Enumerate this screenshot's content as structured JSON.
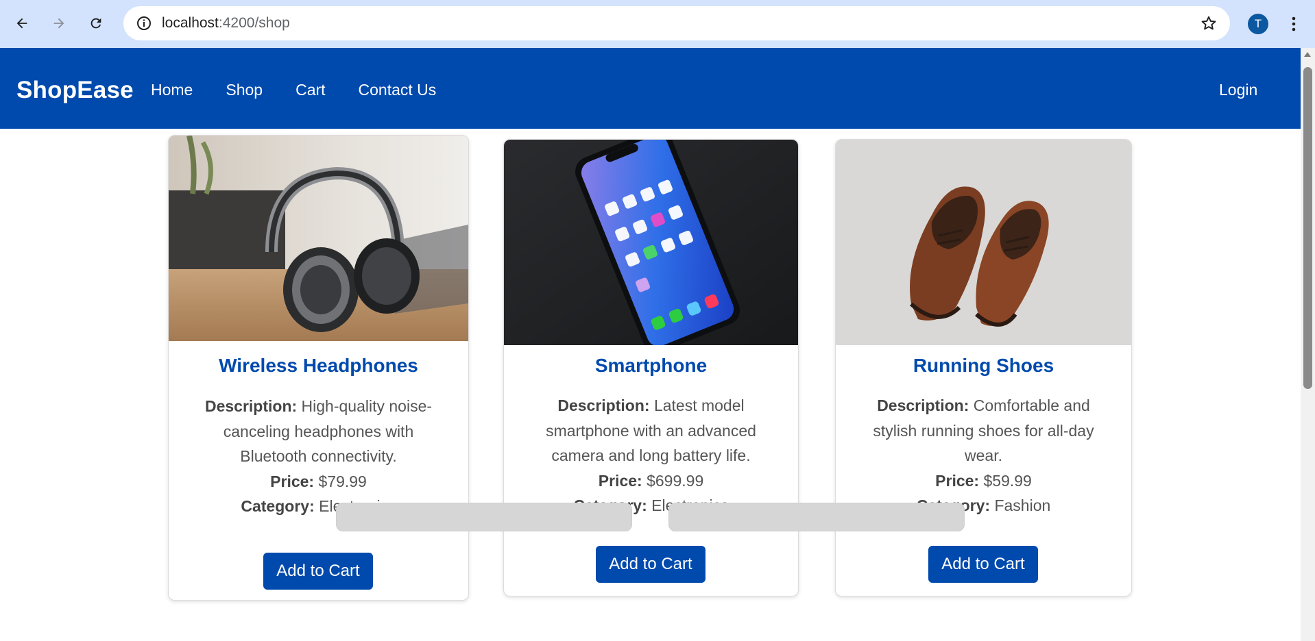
{
  "browser": {
    "url_host": "localhost",
    "url_path": ":4200/shop",
    "profile_initial": "T"
  },
  "navbar": {
    "brand": "ShopEase",
    "links": [
      "Home",
      "Shop",
      "Cart",
      "Contact Us"
    ],
    "login": "Login",
    "bg_color": "#004aad"
  },
  "products": [
    {
      "title": "Wireless Headphones",
      "description_label": "Description:",
      "description": "High-quality noise-canceling headphones with Bluetooth connectivity.",
      "price_label": "Price:",
      "price": "$79.99",
      "category_label": "Category:",
      "category": "Electronics",
      "button": "Add to Cart",
      "image": "headphones-photo"
    },
    {
      "title": "Smartphone",
      "description_label": "Description:",
      "description": "Latest model smartphone with an advanced camera and long battery life.",
      "price_label": "Price:",
      "price": "$699.99",
      "category_label": "Category:",
      "category": "Electronics",
      "button": "Add to Cart",
      "image": "smartphone-photo"
    },
    {
      "title": "Running Shoes",
      "description_label": "Description:",
      "description": "Comfortable and stylish running shoes for all-day wear.",
      "price_label": "Price:",
      "price": "$59.99",
      "category_label": "Category:",
      "category": "Fashion",
      "button": "Add to Cart",
      "image": "shoes-photo"
    }
  ]
}
